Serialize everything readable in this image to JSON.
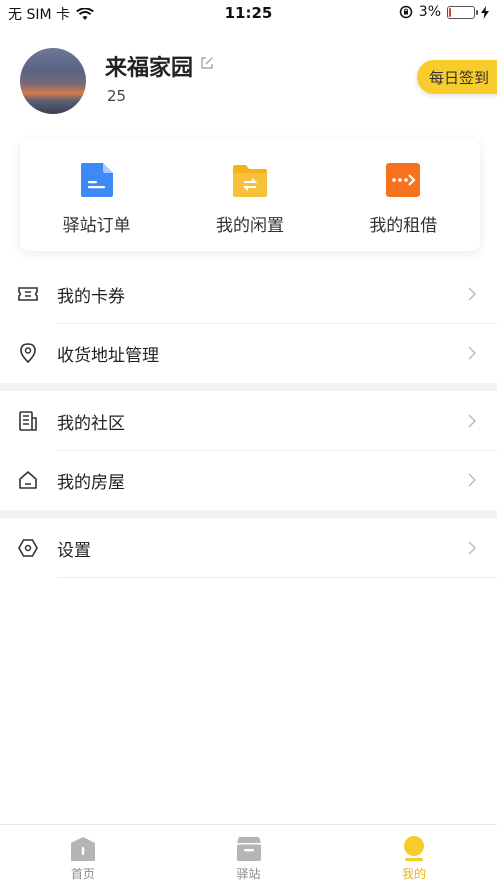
{
  "status_bar": {
    "carrier": "无 SIM 卡",
    "time": "11:25",
    "battery_percent": "3%",
    "battery_level": 0.03,
    "battery_color": "#e53935"
  },
  "profile": {
    "name": "来福家园",
    "count": "25",
    "signin_label": "每日签到",
    "accent_color": "#f8cc2b"
  },
  "shortcuts": [
    {
      "label": "驿站订单",
      "icon": "document-icon",
      "color": "#3d8af7"
    },
    {
      "label": "我的闲置",
      "icon": "folder-swap-icon",
      "color": "#f5b31a"
    },
    {
      "label": "我的租借",
      "icon": "arrow-right-box-icon",
      "color": "#f5731e"
    }
  ],
  "menu": {
    "coupons": {
      "label": "我的卡券",
      "icon": "ticket-icon"
    },
    "address": {
      "label": "收货地址管理",
      "icon": "location-pin-icon"
    },
    "community": {
      "label": "我的社区",
      "icon": "building-icon"
    },
    "house": {
      "label": "我的房屋",
      "icon": "house-icon"
    },
    "settings": {
      "label": "设置",
      "icon": "hexagon-settings-icon"
    }
  },
  "tabbar": {
    "tabs": [
      {
        "label": "首页",
        "icon": "home-icon"
      },
      {
        "label": "驿站",
        "icon": "box-icon"
      },
      {
        "label": "我的",
        "icon": "user-icon"
      }
    ],
    "active_color": "#f0b400"
  }
}
